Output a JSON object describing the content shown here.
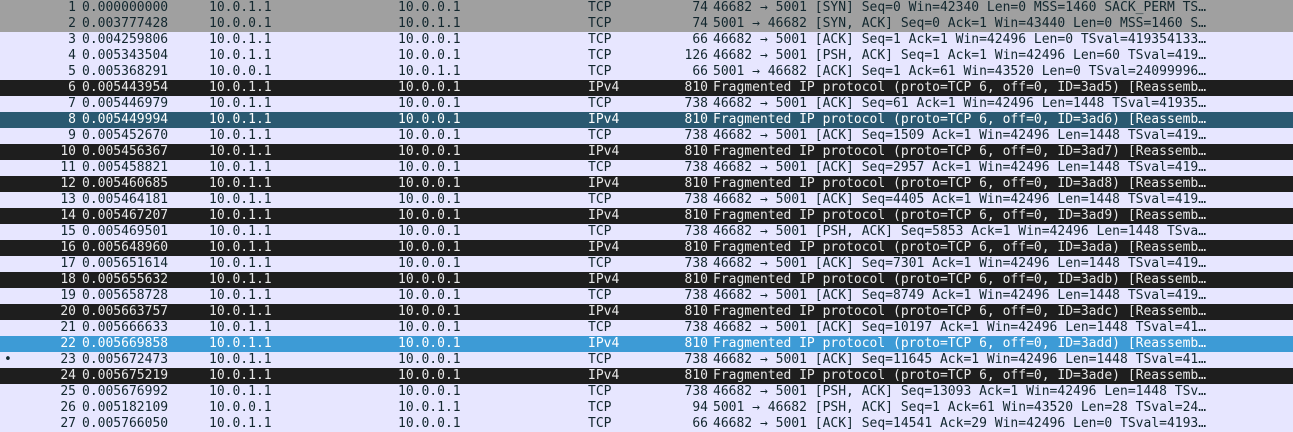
{
  "packet_list": {
    "current_marker": "•",
    "style_colors": {
      "syn": {
        "bg": "#a0a0a0",
        "fg": "#12272e"
      },
      "tcp": {
        "bg": "#e7e6ff",
        "fg": "#12272e"
      },
      "frag": {
        "bg": "#1e1e1e",
        "fg": "#e8e8e8"
      },
      "sel_dark": {
        "bg": "#2a5971",
        "fg": "#ffffff"
      },
      "sel": {
        "bg": "#3d9bd6",
        "fg": "#ffffff"
      }
    },
    "rows": [
      {
        "no": "1",
        "time": "0.000000000",
        "src": "10.0.1.1",
        "dst": "10.0.0.1",
        "proto": "TCP",
        "len": "74",
        "info": "46682 → 5001 [SYN] Seq=0 Win=42340 Len=0 MSS=1460 SACK_PERM TS…",
        "style": "syn",
        "current": false
      },
      {
        "no": "2",
        "time": "0.003777428",
        "src": "10.0.0.1",
        "dst": "10.0.1.1",
        "proto": "TCP",
        "len": "74",
        "info": "5001 → 46682 [SYN, ACK] Seq=0 Ack=1 Win=43440 Len=0 MSS=1460 S…",
        "style": "syn",
        "current": false
      },
      {
        "no": "3",
        "time": "0.004259806",
        "src": "10.0.1.1",
        "dst": "10.0.0.1",
        "proto": "TCP",
        "len": "66",
        "info": "46682 → 5001 [ACK] Seq=1 Ack=1 Win=42496 Len=0 TSval=419354133…",
        "style": "tcp",
        "current": false
      },
      {
        "no": "4",
        "time": "0.005343504",
        "src": "10.0.1.1",
        "dst": "10.0.0.1",
        "proto": "TCP",
        "len": "126",
        "info": "46682 → 5001 [PSH, ACK] Seq=1 Ack=1 Win=42496 Len=60 TSval=419…",
        "style": "tcp",
        "current": false
      },
      {
        "no": "5",
        "time": "0.005368291",
        "src": "10.0.0.1",
        "dst": "10.0.1.1",
        "proto": "TCP",
        "len": "66",
        "info": "5001 → 46682 [ACK] Seq=1 Ack=61 Win=43520 Len=0 TSval=24099996…",
        "style": "tcp",
        "current": false
      },
      {
        "no": "6",
        "time": "0.005443954",
        "src": "10.0.1.1",
        "dst": "10.0.0.1",
        "proto": "IPv4",
        "len": "810",
        "info": "Fragmented IP protocol (proto=TCP 6, off=0, ID=3ad5) [Reassemb…",
        "style": "frag",
        "current": false
      },
      {
        "no": "7",
        "time": "0.005446979",
        "src": "10.0.1.1",
        "dst": "10.0.0.1",
        "proto": "TCP",
        "len": "738",
        "info": "46682 → 5001 [ACK] Seq=61 Ack=1 Win=42496 Len=1448 TSval=41935…",
        "style": "tcp",
        "current": false
      },
      {
        "no": "8",
        "time": "0.005449994",
        "src": "10.0.1.1",
        "dst": "10.0.0.1",
        "proto": "IPv4",
        "len": "810",
        "info": "Fragmented IP protocol (proto=TCP 6, off=0, ID=3ad6) [Reassemb…",
        "style": "sel_dark",
        "current": false
      },
      {
        "no": "9",
        "time": "0.005452670",
        "src": "10.0.1.1",
        "dst": "10.0.0.1",
        "proto": "TCP",
        "len": "738",
        "info": "46682 → 5001 [ACK] Seq=1509 Ack=1 Win=42496 Len=1448 TSval=419…",
        "style": "tcp",
        "current": false
      },
      {
        "no": "10",
        "time": "0.005456367",
        "src": "10.0.1.1",
        "dst": "10.0.0.1",
        "proto": "IPv4",
        "len": "810",
        "info": "Fragmented IP protocol (proto=TCP 6, off=0, ID=3ad7) [Reassemb…",
        "style": "frag",
        "current": false
      },
      {
        "no": "11",
        "time": "0.005458821",
        "src": "10.0.1.1",
        "dst": "10.0.0.1",
        "proto": "TCP",
        "len": "738",
        "info": "46682 → 5001 [ACK] Seq=2957 Ack=1 Win=42496 Len=1448 TSval=419…",
        "style": "tcp",
        "current": false
      },
      {
        "no": "12",
        "time": "0.005460685",
        "src": "10.0.1.1",
        "dst": "10.0.0.1",
        "proto": "IPv4",
        "len": "810",
        "info": "Fragmented IP protocol (proto=TCP 6, off=0, ID=3ad8) [Reassemb…",
        "style": "frag",
        "current": false
      },
      {
        "no": "13",
        "time": "0.005464181",
        "src": "10.0.1.1",
        "dst": "10.0.0.1",
        "proto": "TCP",
        "len": "738",
        "info": "46682 → 5001 [ACK] Seq=4405 Ack=1 Win=42496 Len=1448 TSval=419…",
        "style": "tcp",
        "current": false
      },
      {
        "no": "14",
        "time": "0.005467207",
        "src": "10.0.1.1",
        "dst": "10.0.0.1",
        "proto": "IPv4",
        "len": "810",
        "info": "Fragmented IP protocol (proto=TCP 6, off=0, ID=3ad9) [Reassemb…",
        "style": "frag",
        "current": false
      },
      {
        "no": "15",
        "time": "0.005469501",
        "src": "10.0.1.1",
        "dst": "10.0.0.1",
        "proto": "TCP",
        "len": "738",
        "info": "46682 → 5001 [PSH, ACK] Seq=5853 Ack=1 Win=42496 Len=1448 TSva…",
        "style": "tcp",
        "current": false
      },
      {
        "no": "16",
        "time": "0.005648960",
        "src": "10.0.1.1",
        "dst": "10.0.0.1",
        "proto": "IPv4",
        "len": "810",
        "info": "Fragmented IP protocol (proto=TCP 6, off=0, ID=3ada) [Reassemb…",
        "style": "frag",
        "current": false
      },
      {
        "no": "17",
        "time": "0.005651614",
        "src": "10.0.1.1",
        "dst": "10.0.0.1",
        "proto": "TCP",
        "len": "738",
        "info": "46682 → 5001 [ACK] Seq=7301 Ack=1 Win=42496 Len=1448 TSval=419…",
        "style": "tcp",
        "current": false
      },
      {
        "no": "18",
        "time": "0.005655632",
        "src": "10.0.1.1",
        "dst": "10.0.0.1",
        "proto": "IPv4",
        "len": "810",
        "info": "Fragmented IP protocol (proto=TCP 6, off=0, ID=3adb) [Reassemb…",
        "style": "frag",
        "current": false
      },
      {
        "no": "19",
        "time": "0.005658728",
        "src": "10.0.1.1",
        "dst": "10.0.0.1",
        "proto": "TCP",
        "len": "738",
        "info": "46682 → 5001 [ACK] Seq=8749 Ack=1 Win=42496 Len=1448 TSval=419…",
        "style": "tcp",
        "current": false
      },
      {
        "no": "20",
        "time": "0.005663757",
        "src": "10.0.1.1",
        "dst": "10.0.0.1",
        "proto": "IPv4",
        "len": "810",
        "info": "Fragmented IP protocol (proto=TCP 6, off=0, ID=3adc) [Reassemb…",
        "style": "frag",
        "current": false
      },
      {
        "no": "21",
        "time": "0.005666633",
        "src": "10.0.1.1",
        "dst": "10.0.0.1",
        "proto": "TCP",
        "len": "738",
        "info": "46682 → 5001 [ACK] Seq=10197 Ack=1 Win=42496 Len=1448 TSval=41…",
        "style": "tcp",
        "current": false
      },
      {
        "no": "22",
        "time": "0.005669858",
        "src": "10.0.1.1",
        "dst": "10.0.0.1",
        "proto": "IPv4",
        "len": "810",
        "info": "Fragmented IP protocol (proto=TCP 6, off=0, ID=3add) [Reassemb…",
        "style": "sel",
        "current": false
      },
      {
        "no": "23",
        "time": "0.005672473",
        "src": "10.0.1.1",
        "dst": "10.0.0.1",
        "proto": "TCP",
        "len": "738",
        "info": "46682 → 5001 [ACK] Seq=11645 Ack=1 Win=42496 Len=1448 TSval=41…",
        "style": "tcp",
        "current": true
      },
      {
        "no": "24",
        "time": "0.005675219",
        "src": "10.0.1.1",
        "dst": "10.0.0.1",
        "proto": "IPv4",
        "len": "810",
        "info": "Fragmented IP protocol (proto=TCP 6, off=0, ID=3ade) [Reassemb…",
        "style": "frag",
        "current": false
      },
      {
        "no": "25",
        "time": "0.005676992",
        "src": "10.0.1.1",
        "dst": "10.0.0.1",
        "proto": "TCP",
        "len": "738",
        "info": "46682 → 5001 [PSH, ACK] Seq=13093 Ack=1 Win=42496 Len=1448 TSv…",
        "style": "tcp",
        "current": false
      },
      {
        "no": "26",
        "time": "0.005182109",
        "src": "10.0.0.1",
        "dst": "10.0.1.1",
        "proto": "TCP",
        "len": "94",
        "info": "5001 → 46682 [PSH, ACK] Seq=1 Ack=61 Win=43520 Len=28 TSval=24…",
        "style": "tcp",
        "current": false
      },
      {
        "no": "27",
        "time": "0.005766050",
        "src": "10.0.1.1",
        "dst": "10.0.0.1",
        "proto": "TCP",
        "len": "66",
        "info": "46682 → 5001 [ACK] Seq=14541 Ack=29 Win=42496 Len=0 TSval=4193…",
        "style": "tcp",
        "current": false
      }
    ]
  }
}
